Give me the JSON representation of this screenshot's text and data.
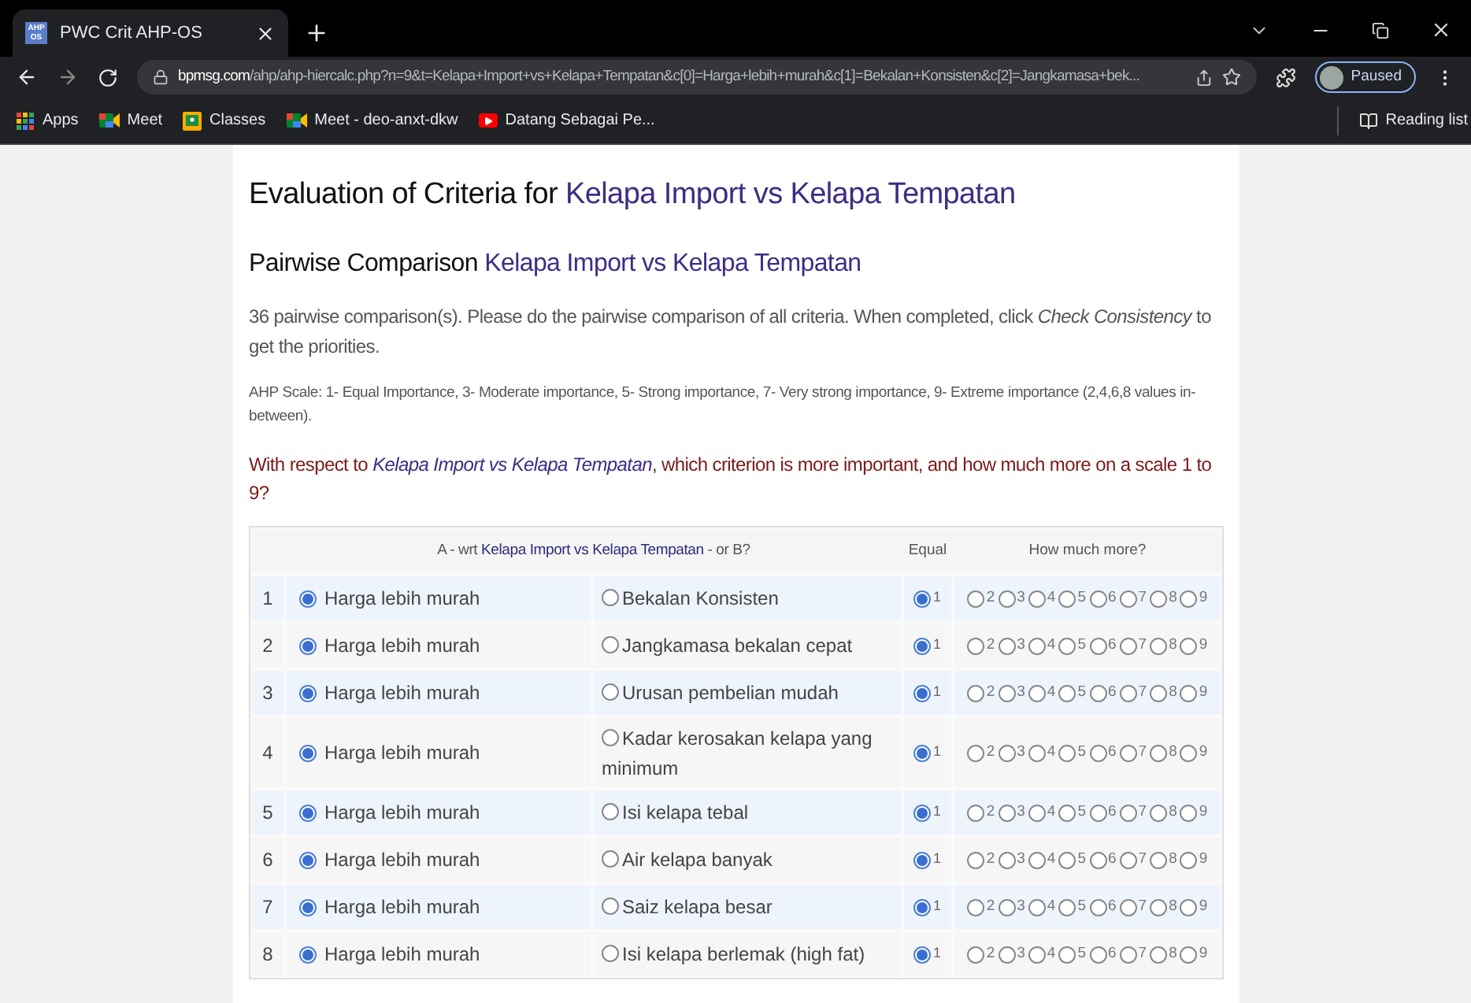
{
  "browser": {
    "tab_title": "PWC Crit AHP-OS",
    "favicon_text": "AHP OS",
    "url_domain": "bpmsg.com",
    "url_path": "/ahp/ahp-hiercalc.php?n=9&t=Kelapa+Import+vs+Kelapa+Tempatan&c[0]=Harga+lebih+murah&c[1]=Bekalan+Konsisten&c[2]=Jangkamasa+bek...",
    "profile_label": "Paused",
    "bookmarks": [
      {
        "label": "Apps",
        "kind": "apps"
      },
      {
        "label": "Meet",
        "kind": "meet"
      },
      {
        "label": "Classes",
        "kind": "classes"
      },
      {
        "label": "Meet - deo-anxt-dkw",
        "kind": "meet"
      },
      {
        "label": "Datang Sebagai Pe...",
        "kind": "video"
      }
    ],
    "reading_list": "Reading list"
  },
  "page": {
    "title_prefix": "Evaluation of Criteria for ",
    "title_subject": "Kelapa Import vs Kelapa Tempatan",
    "subtitle_prefix": "Pairwise Comparison ",
    "subtitle_subject": "Kelapa Import vs Kelapa Tempatan",
    "intro": "36 pairwise comparison(s). Please do the pairwise comparison of all criteria. When completed, click *Check Consistency* to get the priorities.",
    "scale_note": "AHP Scale: 1- Equal Importance, 3- Moderate importance, 5- Strong importance, 7- Very strong importance, 9- Extreme importance (2,4,6,8 values in-between).",
    "question": {
      "prefix": "With respect to ",
      "subject": "Kelapa Import vs Kelapa Tempatan",
      "suffix": ", which criterion is more important, and how much more on a scale 1 to 9?"
    }
  },
  "table": {
    "header": {
      "prefix": "A - wrt ",
      "subject": "Kelapa Import vs Kelapa Tempatan",
      "suffix": " - or B?",
      "equal": "Equal",
      "more": "How much more?"
    },
    "rows": [
      {
        "number": "1",
        "a": {
          "label": "Harga lebih murah",
          "selected": true
        },
        "b": {
          "label": "Bekalan Konsisten",
          "selected": false
        },
        "scale": [
          {
            "value": "1",
            "selected": true
          },
          {
            "value": "2",
            "selected": false
          },
          {
            "value": "3",
            "selected": false
          },
          {
            "value": "4",
            "selected": false
          },
          {
            "value": "5",
            "selected": false
          },
          {
            "value": "6",
            "selected": false
          },
          {
            "value": "7",
            "selected": false
          },
          {
            "value": "8",
            "selected": false
          },
          {
            "value": "9",
            "selected": false
          }
        ]
      },
      {
        "number": "2",
        "a": {
          "label": "Harga lebih murah",
          "selected": true
        },
        "b": {
          "label": "Jangkamasa bekalan cepat",
          "selected": false
        },
        "scale": [
          {
            "value": "1",
            "selected": true
          },
          {
            "value": "2",
            "selected": false
          },
          {
            "value": "3",
            "selected": false
          },
          {
            "value": "4",
            "selected": false
          },
          {
            "value": "5",
            "selected": false
          },
          {
            "value": "6",
            "selected": false
          },
          {
            "value": "7",
            "selected": false
          },
          {
            "value": "8",
            "selected": false
          },
          {
            "value": "9",
            "selected": false
          }
        ]
      },
      {
        "number": "3",
        "a": {
          "label": "Harga lebih murah",
          "selected": true
        },
        "b": {
          "label": "Urusan pembelian mudah",
          "selected": false
        },
        "scale": [
          {
            "value": "1",
            "selected": true
          },
          {
            "value": "2",
            "selected": false
          },
          {
            "value": "3",
            "selected": false
          },
          {
            "value": "4",
            "selected": false
          },
          {
            "value": "5",
            "selected": false
          },
          {
            "value": "6",
            "selected": false
          },
          {
            "value": "7",
            "selected": false
          },
          {
            "value": "8",
            "selected": false
          },
          {
            "value": "9",
            "selected": false
          }
        ]
      },
      {
        "number": "4",
        "a": {
          "label": "Harga lebih murah",
          "selected": true
        },
        "b": {
          "label": "Kadar kerosakan kelapa yang minimum",
          "selected": false
        },
        "scale": [
          {
            "value": "1",
            "selected": true
          },
          {
            "value": "2",
            "selected": false
          },
          {
            "value": "3",
            "selected": false
          },
          {
            "value": "4",
            "selected": false
          },
          {
            "value": "5",
            "selected": false
          },
          {
            "value": "6",
            "selected": false
          },
          {
            "value": "7",
            "selected": false
          },
          {
            "value": "8",
            "selected": false
          },
          {
            "value": "9",
            "selected": false
          }
        ]
      },
      {
        "number": "5",
        "a": {
          "label": "Harga lebih murah",
          "selected": true
        },
        "b": {
          "label": "Isi kelapa tebal",
          "selected": false
        },
        "scale": [
          {
            "value": "1",
            "selected": true
          },
          {
            "value": "2",
            "selected": false
          },
          {
            "value": "3",
            "selected": false
          },
          {
            "value": "4",
            "selected": false
          },
          {
            "value": "5",
            "selected": false
          },
          {
            "value": "6",
            "selected": false
          },
          {
            "value": "7",
            "selected": false
          },
          {
            "value": "8",
            "selected": false
          },
          {
            "value": "9",
            "selected": false
          }
        ]
      },
      {
        "number": "6",
        "a": {
          "label": "Harga lebih murah",
          "selected": true
        },
        "b": {
          "label": "Air kelapa banyak",
          "selected": false
        },
        "scale": [
          {
            "value": "1",
            "selected": true
          },
          {
            "value": "2",
            "selected": false
          },
          {
            "value": "3",
            "selected": false
          },
          {
            "value": "4",
            "selected": false
          },
          {
            "value": "5",
            "selected": false
          },
          {
            "value": "6",
            "selected": false
          },
          {
            "value": "7",
            "selected": false
          },
          {
            "value": "8",
            "selected": false
          },
          {
            "value": "9",
            "selected": false
          }
        ]
      },
      {
        "number": "7",
        "a": {
          "label": "Harga lebih murah",
          "selected": true
        },
        "b": {
          "label": "Saiz kelapa besar",
          "selected": false
        },
        "scale": [
          {
            "value": "1",
            "selected": true
          },
          {
            "value": "2",
            "selected": false
          },
          {
            "value": "3",
            "selected": false
          },
          {
            "value": "4",
            "selected": false
          },
          {
            "value": "5",
            "selected": false
          },
          {
            "value": "6",
            "selected": false
          },
          {
            "value": "7",
            "selected": false
          },
          {
            "value": "8",
            "selected": false
          },
          {
            "value": "9",
            "selected": false
          }
        ]
      },
      {
        "number": "8",
        "a": {
          "label": "Harga lebih murah",
          "selected": true
        },
        "b": {
          "label": "Isi kelapa berlemak (high fat)",
          "selected": false
        },
        "scale": [
          {
            "value": "1",
            "selected": true
          },
          {
            "value": "2",
            "selected": false
          },
          {
            "value": "3",
            "selected": false
          },
          {
            "value": "4",
            "selected": false
          },
          {
            "value": "5",
            "selected": false
          },
          {
            "value": "6",
            "selected": false
          },
          {
            "value": "7",
            "selected": false
          },
          {
            "value": "8",
            "selected": false
          },
          {
            "value": "9",
            "selected": false
          }
        ]
      }
    ]
  }
}
